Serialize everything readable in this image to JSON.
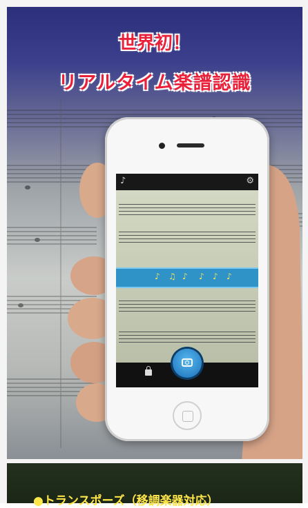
{
  "promo": {
    "headline_line1": "世界初！",
    "headline_line2": "リアルタイム楽譜認識"
  },
  "footer": {
    "feature_text": "●トランスポーズ（移調楽器対応）"
  },
  "colors": {
    "headline": "#e8203a",
    "highlight_band": "#2f93c8",
    "footer_text": "#ffe64a"
  },
  "icons": [
    "music-note-icon",
    "camera-icon",
    "lock-icon",
    "settings-icon",
    "home-button-icon"
  ]
}
